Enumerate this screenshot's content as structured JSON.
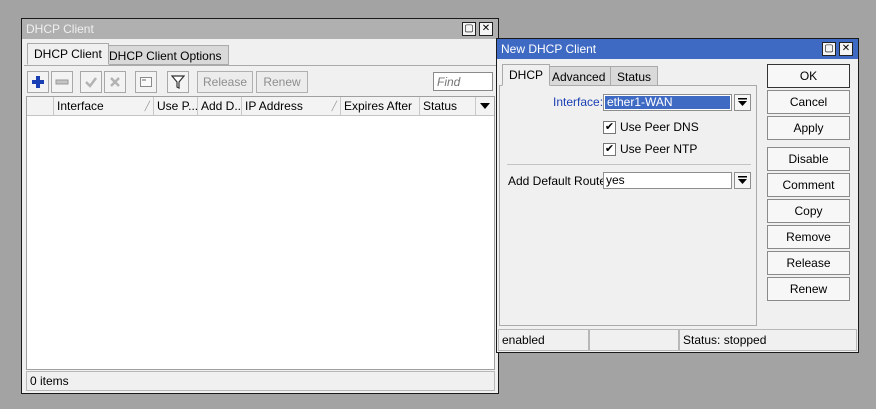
{
  "colors": {
    "desktop": "#a3a3a3",
    "active_titlebar": "#3f6ac4",
    "inactive_titlebar": "#b0b0b0",
    "selection": "#3f6ac4",
    "interface_label": "#1a3fb4"
  },
  "list_window": {
    "title": "DHCP Client",
    "tabs": [
      "DHCP Client",
      "DHCP Client Options"
    ],
    "toolbar": {
      "release_label": "Release",
      "renew_label": "Renew",
      "find_placeholder": "Find"
    },
    "columns": [
      "Interface",
      "Use P...",
      "Add D...",
      "IP Address",
      "Expires After",
      "Status"
    ],
    "rows": [],
    "status_text": "0 items",
    "icons": [
      "add-icon",
      "remove-icon",
      "enable-icon",
      "disable-icon",
      "comment-icon",
      "filter-icon"
    ]
  },
  "dialog": {
    "title": "New DHCP Client",
    "tabs": [
      "DHCP",
      "Advanced",
      "Status"
    ],
    "interface_label": "Interface:",
    "interface_value": "ether1-WAN",
    "use_peer_dns_label": "Use Peer DNS",
    "use_peer_dns_checked": true,
    "use_peer_ntp_label": "Use Peer NTP",
    "use_peer_ntp_checked": true,
    "default_route_label": "Add Default Route:",
    "default_route_value": "yes",
    "buttons": [
      "OK",
      "Cancel",
      "Apply",
      "Disable",
      "Comment",
      "Copy",
      "Remove",
      "Release",
      "Renew"
    ],
    "status_bar": {
      "state": "enabled",
      "middle": "",
      "status": "Status: stopped"
    }
  }
}
